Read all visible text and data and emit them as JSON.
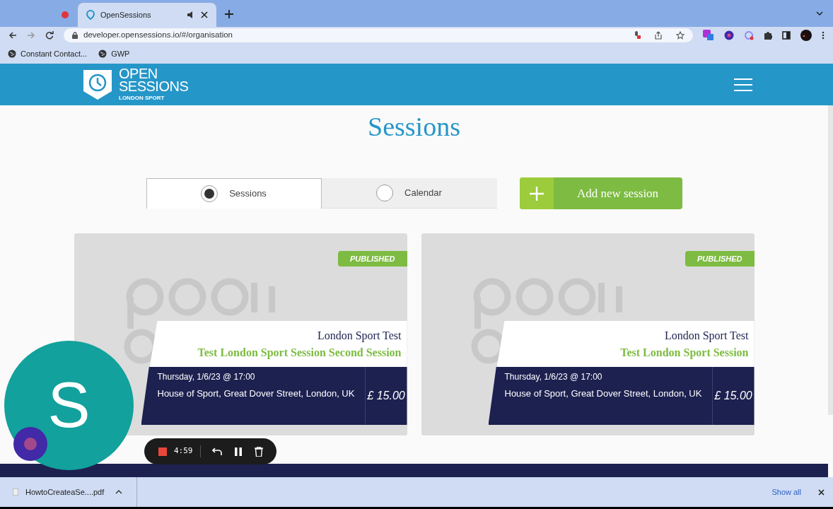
{
  "browser": {
    "tabs": [
      {
        "kind": "recording",
        "selected": false
      },
      {
        "kind": "page",
        "title": "OpenSessions",
        "selected": true
      }
    ],
    "url": "developer.opensessions.io/#/organisation",
    "bookmarks": [
      "Constant Contact...",
      "GWP"
    ]
  },
  "site": {
    "logo": {
      "line_1": "OPEN",
      "line_2": "SESSIONS",
      "brand": "LONDON SPORT"
    },
    "heading": "Sessions",
    "view_toggle": [
      {
        "label": "Sessions",
        "selected": true
      },
      {
        "label": "Calendar",
        "selected": false
      }
    ],
    "add_button": "Add new session",
    "sessions": [
      {
        "status": "PUBLISHED",
        "organiser": "London Sport Test",
        "title": "Test London Sport Session Second Session",
        "datetime": "Thursday, 1/6/23 @ 17:00",
        "location": "House of Sport, Great Dover Street, London, UK",
        "price": "£ 15.00"
      },
      {
        "status": "PUBLISHED",
        "organiser": "London Sport Test",
        "title": "Test London Sport Session",
        "datetime": "Thursday, 1/6/23 @ 17:00",
        "location": "House of Sport, Great Dover Street, London, UK",
        "price": "£ 15.00"
      }
    ]
  },
  "recorder": {
    "avatar_letter": "S",
    "timer": "4:59"
  },
  "download_bar": {
    "file": "HowtoCreateaSe....pdf",
    "show_all": "Show all"
  }
}
